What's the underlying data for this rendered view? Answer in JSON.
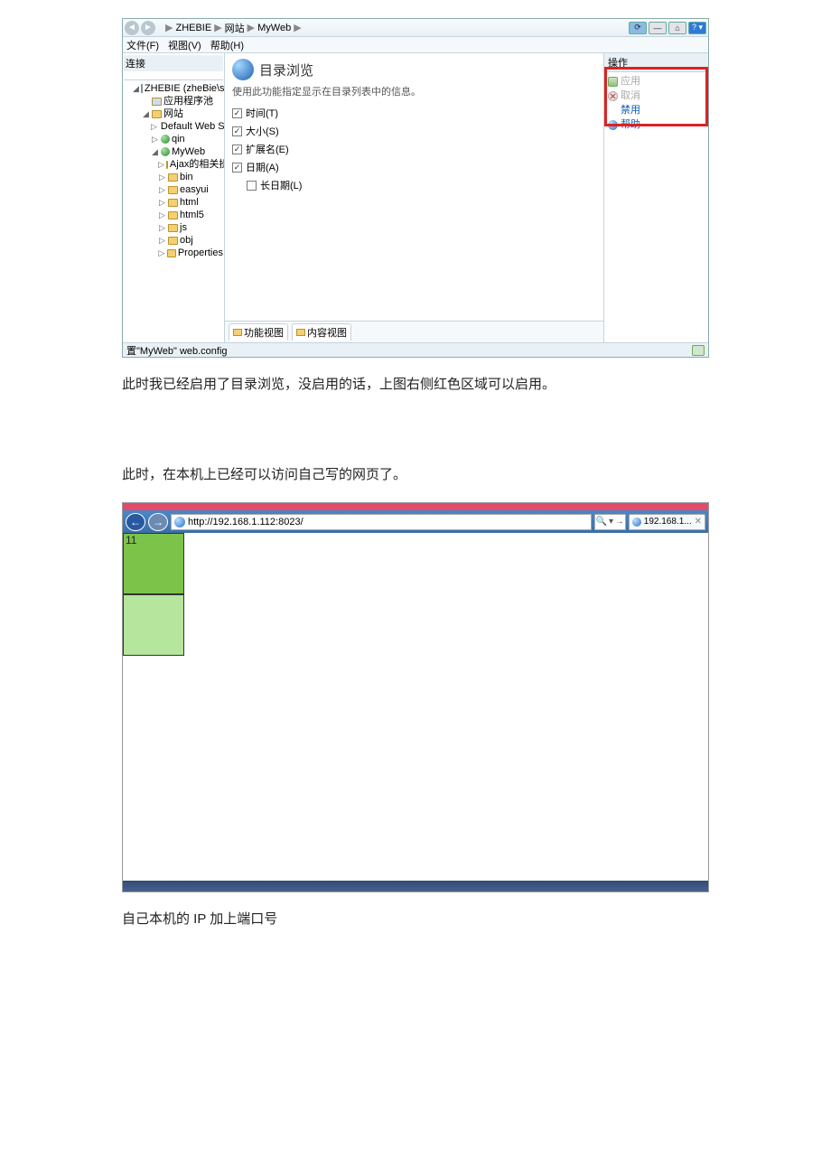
{
  "iis": {
    "breadcrumb": [
      "ZHEBIE",
      "网站",
      "MyWeb"
    ],
    "menu": {
      "file": "文件(F)",
      "view": "视图(V)",
      "help": "帮助(H)"
    },
    "tree": {
      "header": "连接",
      "server": "ZHEBIE (zheBie\\sa)",
      "appPools": "应用程序池",
      "sites": "网站",
      "siteDefault": "Default Web Site",
      "siteQin": "qin",
      "siteMyWeb": "MyWeb",
      "folders": [
        "Ajax的相关操作",
        "bin",
        "easyui",
        "html",
        "html5",
        "js",
        "obj",
        "Properties"
      ]
    },
    "content": {
      "title": "目录浏览",
      "desc": "使用此功能指定显示在目录列表中的信息。",
      "checks": {
        "time": "时间(T)",
        "size": "大小(S)",
        "ext": "扩展名(E)",
        "date": "日期(A)",
        "longDate": "长日期(L)"
      },
      "tabs": {
        "features": "功能视图",
        "content": "内容视图"
      }
    },
    "actions": {
      "header": "操作",
      "apply": "应用",
      "cancel": "取消",
      "disable": "禁用",
      "help": "帮助"
    },
    "status": "置\"MyWeb\" web.config"
  },
  "para1": "此时我已经启用了目录浏览，没启用的话，上图右侧红色区域可以启用。",
  "para2": "此时，在本机上已经可以访问自己写的网页了。",
  "ie": {
    "url": "http://192.168.1.112:8023/",
    "tab": "192.168.1...",
    "num": "11"
  },
  "para3": "自己本机的 IP 加上端口号"
}
